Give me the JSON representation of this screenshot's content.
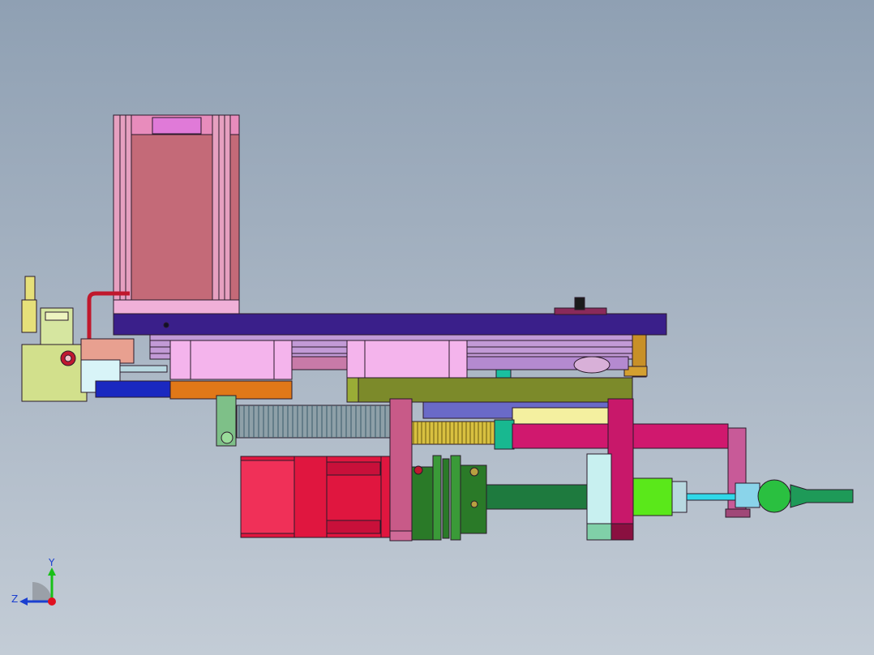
{
  "viewport": {
    "background_top": "#8fa0b3",
    "background_bottom": "#c3ccd6"
  },
  "triad": {
    "y_label": "Y",
    "z_label": "Z",
    "y_color": "#18c018",
    "z_color": "#1a3fd0",
    "x_color": "#e01020"
  },
  "model": {
    "motor_color": "#c46a78",
    "servo_color": "#e0163f",
    "plate_color": "#3a1f8a",
    "bracket_color": "#d0186e",
    "rail_color": "#7c8a2a",
    "shaft_color": "#1e7a3e",
    "spring_left_color": "#8ea0a8",
    "spring_right_color": "#d8c040"
  }
}
